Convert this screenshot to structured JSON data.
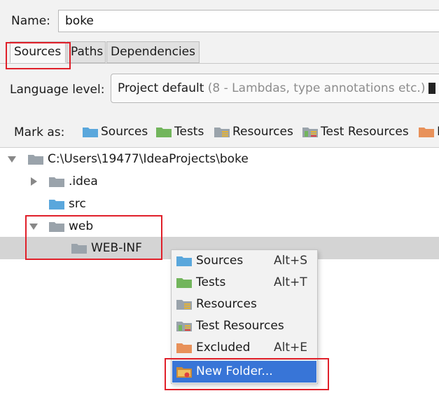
{
  "name_field": {
    "label": "Name:",
    "value": "boke"
  },
  "tabs": [
    {
      "label": "Sources",
      "active": true
    },
    {
      "label": "Paths",
      "active": false
    },
    {
      "label": "Dependencies",
      "active": false
    }
  ],
  "language_level": {
    "label": "Language level:",
    "selected": "Project default",
    "selected_hint": "(8 - Lambdas, type annotations etc.)"
  },
  "mark_as": {
    "label": "Mark as:",
    "items": [
      {
        "label": "Sources",
        "icon": "sources-folder-icon",
        "color": "#5aa7dc"
      },
      {
        "label": "Tests",
        "icon": "tests-folder-icon",
        "color": "#72b55c"
      },
      {
        "label": "Resources",
        "icon": "resources-folder-icon",
        "color": "#9aa3ab"
      },
      {
        "label": "Test Resources",
        "icon": "test-resources-folder-icon",
        "color": "#9aa3ab"
      },
      {
        "label": "E",
        "icon": "excluded-folder-icon",
        "color": "#e8915a"
      }
    ]
  },
  "tree": {
    "root": "C:\\Users\\19477\\IdeaProjects\\boke",
    "children": [
      {
        "label": ".idea",
        "expanded": false
      },
      {
        "label": "src",
        "type": "source"
      },
      {
        "label": "web",
        "expanded": true,
        "children": [
          {
            "label": "WEB-INF",
            "selected": true
          }
        ]
      }
    ]
  },
  "context_menu": {
    "items": [
      {
        "label": "Sources",
        "shortcut": "Alt+S",
        "icon": "sources-folder-icon"
      },
      {
        "label": "Tests",
        "shortcut": "Alt+T",
        "icon": "tests-folder-icon"
      },
      {
        "label": "Resources",
        "shortcut": "",
        "icon": "resources-folder-icon"
      },
      {
        "label": "Test Resources",
        "shortcut": "",
        "icon": "test-resources-folder-icon"
      },
      {
        "label": "Excluded",
        "shortcut": "Alt+E",
        "icon": "excluded-folder-icon"
      },
      {
        "label": "New Folder...",
        "shortcut": "",
        "icon": "new-folder-icon",
        "highlighted": true
      }
    ]
  },
  "colors": {
    "selection": "#3875d7",
    "annotation_red": "#e0202a",
    "folder_grey": "#9aa3ab",
    "folder_blue": "#5aa7dc"
  }
}
